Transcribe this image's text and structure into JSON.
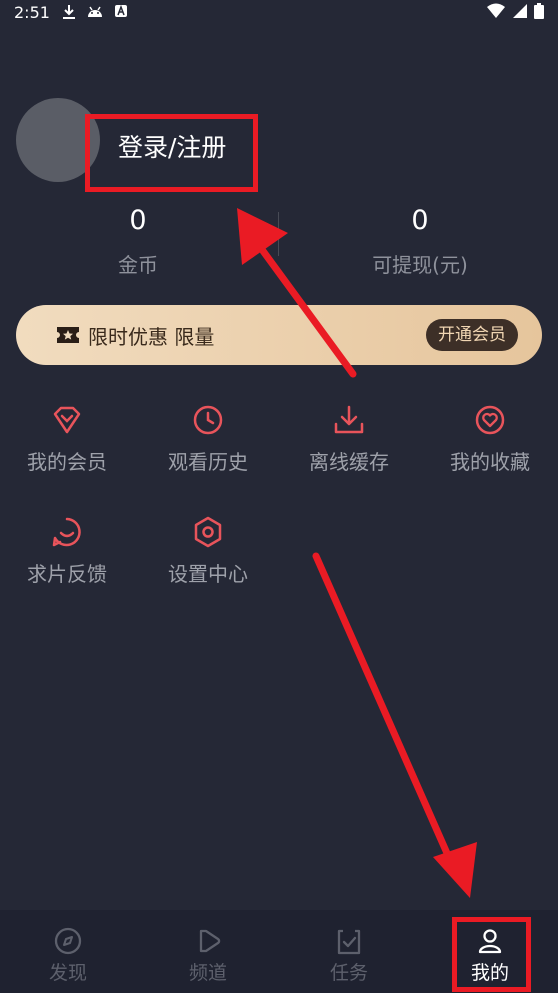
{
  "status_bar": {
    "time": "2:51"
  },
  "profile": {
    "login_label": "登录/注册"
  },
  "stats": [
    {
      "value": "0",
      "label": "金币"
    },
    {
      "value": "0",
      "label": "可提现(元)"
    }
  ],
  "vip_banner": {
    "text": "限时优惠 限量",
    "button": "开通会员"
  },
  "menu": {
    "vip": "我的会员",
    "history": "观看历史",
    "offline": "离线缓存",
    "favorites": "我的收藏",
    "feedback": "求片反馈",
    "settings": "设置中心"
  },
  "tabs": {
    "discover": "发现",
    "channel": "频道",
    "tasks": "任务",
    "mine": "我的"
  },
  "colors": {
    "background": "#252836",
    "accent_red": "#e8545b",
    "annotation": "#ea1b24"
  }
}
